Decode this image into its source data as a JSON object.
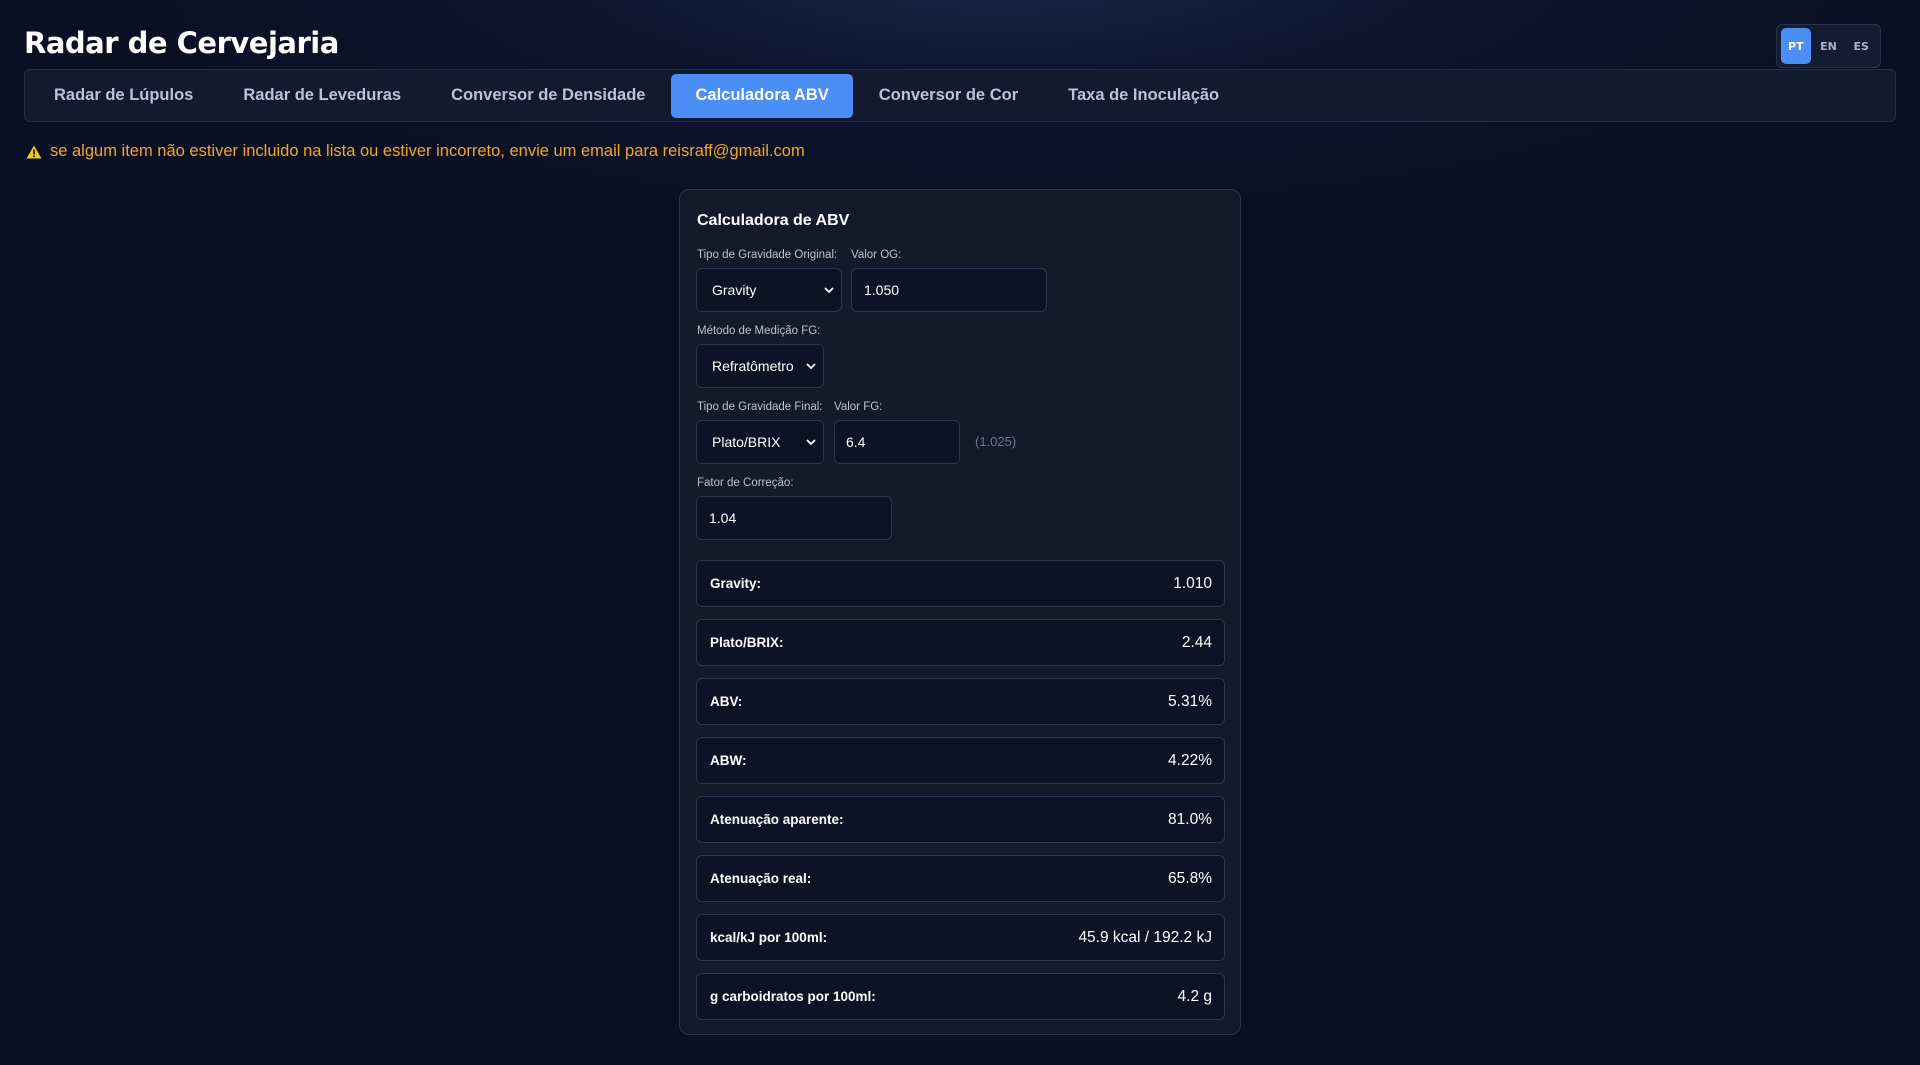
{
  "app": {
    "title": "Radar de Cervejaria"
  },
  "languages": [
    {
      "label": "PT",
      "active": true
    },
    {
      "label": "EN",
      "active": false
    },
    {
      "label": "ES",
      "active": false
    }
  ],
  "tabs": [
    {
      "label": "Radar de Lúpulos",
      "active": false
    },
    {
      "label": "Radar de Leveduras",
      "active": false
    },
    {
      "label": "Conversor de Densidade",
      "active": false
    },
    {
      "label": "Calculadora ABV",
      "active": true
    },
    {
      "label": "Conversor de Cor",
      "active": false
    },
    {
      "label": "Taxa de Inoculação",
      "active": false
    }
  ],
  "notice": {
    "icon": "warning-icon",
    "text": "se algum item não estiver incluido na lista ou estiver incorreto, envie um email para reisraff@gmail.com"
  },
  "calculator": {
    "title": "Calculadora de ABV",
    "og_type_label": "Tipo de Gravidade Original:",
    "og_type_value": "Gravity",
    "og_value_label": "Valor OG:",
    "og_value": "1.050",
    "fg_method_label": "Método de Medição FG:",
    "fg_method_value": "Refratômetro",
    "fg_type_label": "Tipo de Gravidade Final:",
    "fg_type_value": "Plato/BRIX",
    "fg_value_label": "Valor FG:",
    "fg_value": "6.4",
    "fg_converted": "(1.025)",
    "correction_label": "Fator de Correção:",
    "correction_value": "1.04"
  },
  "results": [
    {
      "label": "Gravity:",
      "value": "1.010"
    },
    {
      "label": "Plato/BRIX:",
      "value": "2.44"
    },
    {
      "label": "ABV:",
      "value": "5.31%"
    },
    {
      "label": "ABW:",
      "value": "4.22%"
    },
    {
      "label": "Atenuação aparente:",
      "value": "81.0%"
    },
    {
      "label": "Atenuação real:",
      "value": "65.8%"
    },
    {
      "label": "kcal/kJ por 100ml:",
      "value": "45.9 kcal / 192.2 kJ"
    },
    {
      "label": "g carboidratos por 100ml:",
      "value": "4.2 g"
    }
  ],
  "colors": {
    "accent": "#4b8ef5",
    "warning": "#f5a524",
    "background": "#0a1024",
    "panel": "#131a2c"
  }
}
